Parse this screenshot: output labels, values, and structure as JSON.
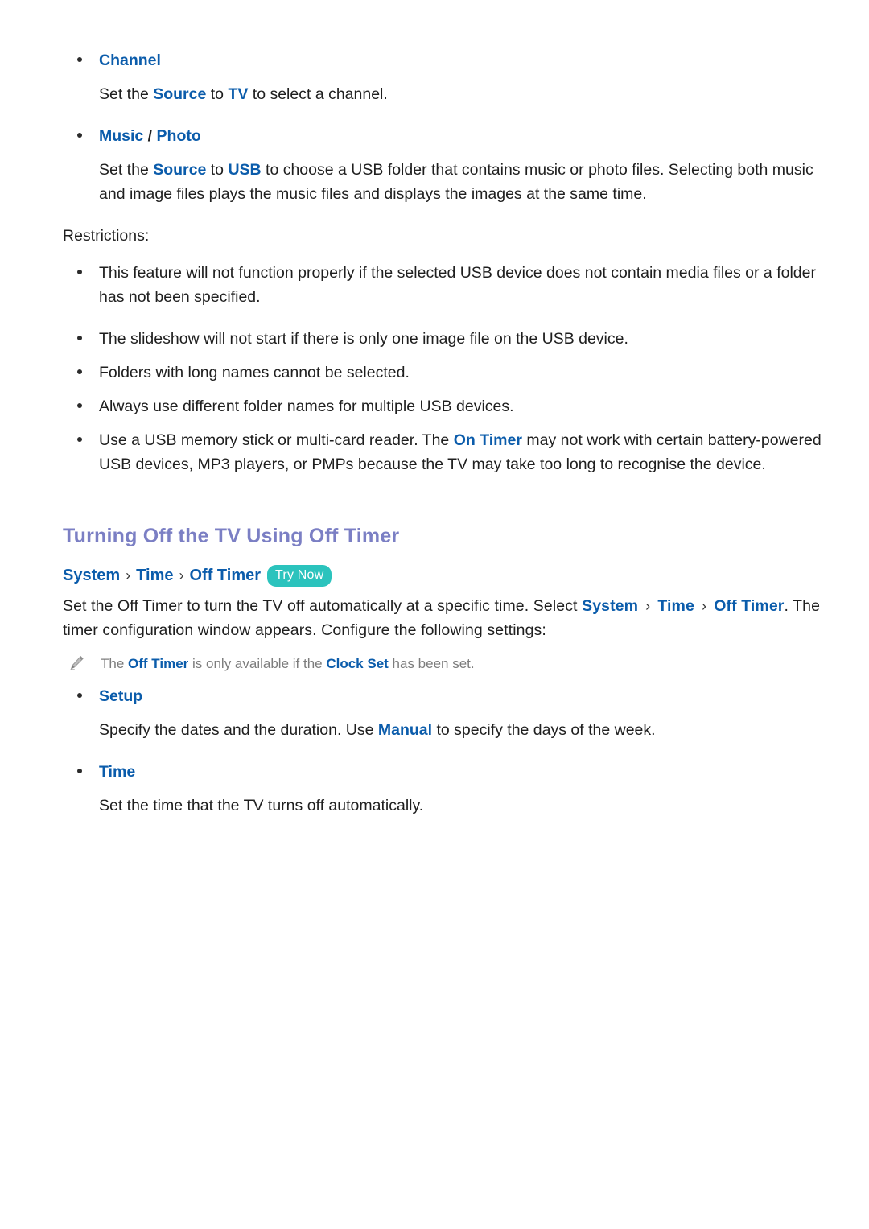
{
  "document": {
    "colors": {
      "link_blue": "#0b5cab",
      "heading_purple": "#7b7fc4",
      "try_now_teal": "#2bc3bd",
      "body_text": "#1f1f1f",
      "note_gray": "#7d7d7d"
    }
  },
  "top_list": {
    "items": [
      {
        "title": "Channel",
        "body_parts": [
          {
            "text": "Set the ",
            "style": "plain"
          },
          {
            "text": "Source",
            "style": "blue-b"
          },
          {
            "text": " to ",
            "style": "plain"
          },
          {
            "text": "TV",
            "style": "blue-b"
          },
          {
            "text": " to select a channel.",
            "style": "plain"
          }
        ]
      },
      {
        "title_parts": [
          {
            "text": "Music",
            "style": "blue-b"
          },
          {
            "text": " / ",
            "style": "plain-dark"
          },
          {
            "text": "Photo",
            "style": "blue-b"
          }
        ],
        "title": "Music / Photo",
        "body_parts": [
          {
            "text": "Set the ",
            "style": "plain"
          },
          {
            "text": "Source",
            "style": "blue-b"
          },
          {
            "text": " to ",
            "style": "plain"
          },
          {
            "text": "USB",
            "style": "blue-b"
          },
          {
            "text": " to choose a USB folder that contains music or photo files. Selecting both music and image files plays the music files and displays the images at the same time.",
            "style": "plain"
          }
        ]
      }
    ]
  },
  "restrictions": {
    "label": "Restrictions:",
    "items": [
      {
        "text": "This feature will not function properly if the selected USB device does not contain media files or a folder has not been specified."
      },
      {
        "text": "The slideshow will not start if there is only one image file on the USB device."
      },
      {
        "text": "Folders with long names cannot be selected."
      },
      {
        "text": "Always use different folder names for multiple USB devices."
      },
      {
        "parts": [
          {
            "text": "Use a USB memory stick or multi-card reader. The ",
            "style": "plain"
          },
          {
            "text": "On Timer",
            "style": "blue-b"
          },
          {
            "text": " may not work with certain battery-powered USB devices, MP3 players, or PMPs because the TV may take too long to recognise the device.",
            "style": "plain"
          }
        ]
      }
    ]
  },
  "section": {
    "heading": "Turning Off the TV Using Off Timer",
    "breadcrumb": {
      "crumbs": [
        "System",
        "Time",
        "Off Timer"
      ],
      "separator": "›",
      "badge": "Try Now"
    },
    "intro_parts": [
      {
        "text": "Set the Off Timer to turn the TV off automatically at a specific time. Select ",
        "style": "plain"
      },
      {
        "text": "System",
        "style": "blue-b"
      },
      {
        "text": " › ",
        "style": "sep"
      },
      {
        "text": "Time",
        "style": "blue-b"
      },
      {
        "text": " › ",
        "style": "sep"
      },
      {
        "text": "Off Timer",
        "style": "blue-b"
      },
      {
        "text": ". The timer configuration window appears. Configure the following settings:",
        "style": "plain"
      }
    ],
    "note": {
      "icon": "pencil-icon",
      "parts": [
        {
          "text": "The ",
          "style": "plain"
        },
        {
          "text": "Off Timer",
          "style": "blue-b"
        },
        {
          "text": " is only available if the ",
          "style": "plain"
        },
        {
          "text": "Clock Set",
          "style": "blue-b"
        },
        {
          "text": " has been set.",
          "style": "plain"
        }
      ]
    },
    "settings": [
      {
        "title": "Setup",
        "body_parts": [
          {
            "text": "Specify the dates and the duration. Use ",
            "style": "plain"
          },
          {
            "text": "Manual",
            "style": "blue-b"
          },
          {
            "text": " to specify the days of the week.",
            "style": "plain"
          }
        ]
      },
      {
        "title": "Time",
        "body_parts": [
          {
            "text": "Set the time that the TV turns off automatically.",
            "style": "plain"
          }
        ]
      }
    ]
  }
}
